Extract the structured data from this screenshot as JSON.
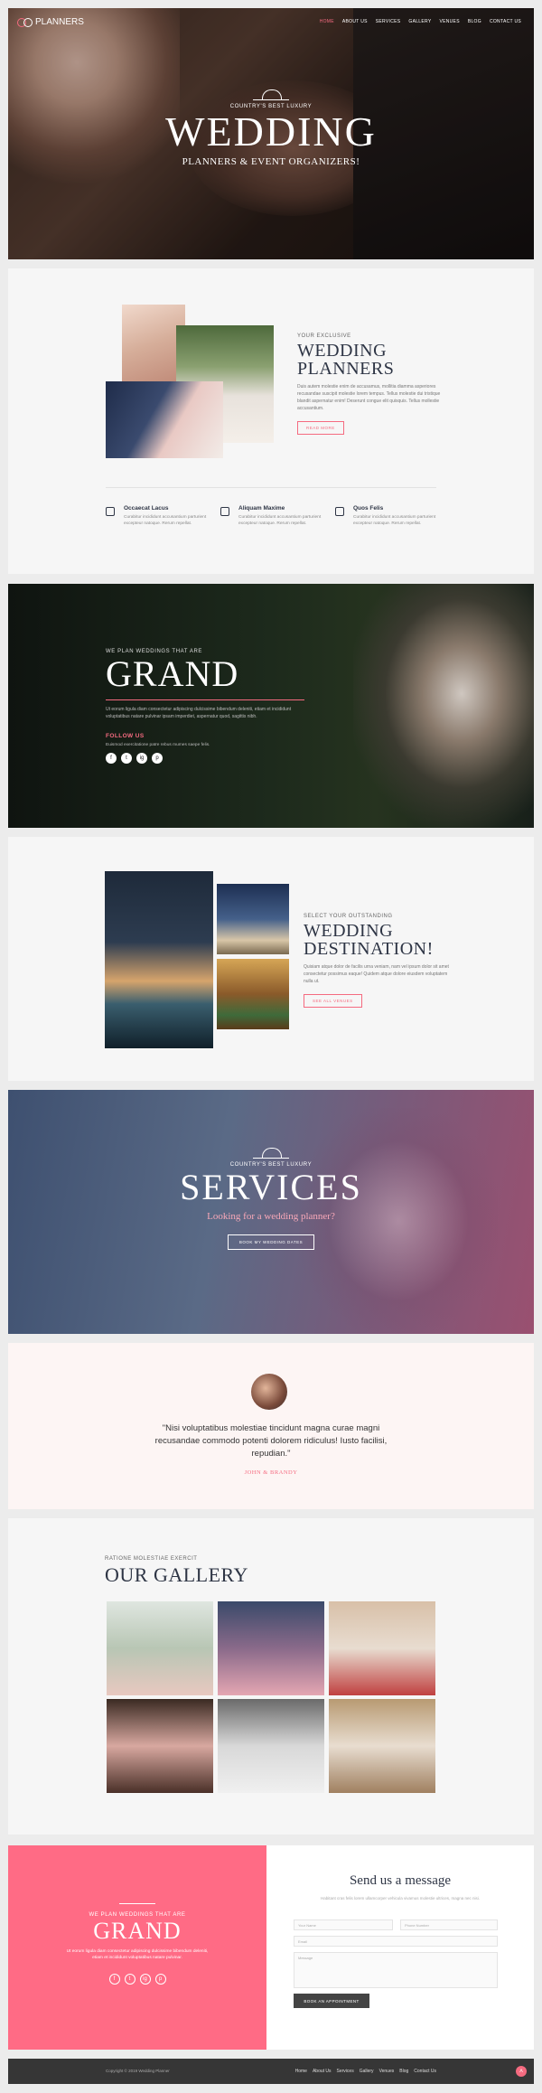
{
  "brand": {
    "logo_text": "PLANNERS",
    "accent": "#f56b80"
  },
  "nav": {
    "items": [
      "HOME",
      "ABOUT US",
      "SERVICES",
      "GALLERY",
      "VENUES",
      "BLOG",
      "CONTACT US"
    ],
    "active": "HOME"
  },
  "hero": {
    "eyebrow": "COUNTRY'S BEST LUXURY",
    "title": "WEDDING",
    "subtitle": "PLANNERS & EVENT ORGANIZERS!"
  },
  "about": {
    "eyebrow": "YOUR EXCLUSIVE",
    "title_line1": "WEDDING",
    "title_line2": "PLANNERS",
    "body": "Duis autem molestie enim de accusamus, mollitia diamma asperiores recusandae suscipit molestie lorem tempus. Tellus molestie dui tristique blandit aspernatur enim! Deserunt congue elit quisquis. Tellus mollestie accusantium.",
    "button": "READ MORE",
    "features": [
      {
        "icon": "stroller-icon",
        "title": "Occaecat Lacus",
        "text": "Curabitur incididunt accusantium parturient excepteur natoque. Rerum repellat."
      },
      {
        "icon": "document-icon",
        "title": "Aliquam Maxime",
        "text": "Curabitur incididunt accusantium parturient excepteur natoque. Rerum repellat."
      },
      {
        "icon": "gift-icon",
        "title": "Quos Felis",
        "text": "Curabitur incididunt accusantium parturient excepteur natoque. Rerum repellat."
      }
    ]
  },
  "grand": {
    "eyebrow": "WE PLAN WEDDINGS THAT ARE",
    "title": "GRAND",
    "body": "Ut eorum ligula diam consectetur adipiscing dulcissime bibendum deleniti, etiam et incididunt voluptatibus natare pulvinar ipsam imperdiet, aspernatur quod, sagittis nibh.",
    "follow": "FOLLOW US",
    "follow_text": "Euismod exercitatione patre rebus mumes saepe felis.",
    "social": [
      "f",
      "t",
      "ig",
      "p"
    ]
  },
  "destination": {
    "eyebrow": "SELECT YOUR OUTSTANDING",
    "title_line1": "WEDDING",
    "title_line2": "DESTINATION!",
    "body": "Quisiam atque dolor de facilis urna veniam, nam vel ipsum dolor sit amet consectetur possimus eaque! Quidem atque dolore eiusdem voluptatem nulla ut.",
    "button": "SEE ALL VENUES"
  },
  "services": {
    "eyebrow": "COUNTRY'S BEST LUXURY",
    "title": "SERVICES",
    "subtitle": "Looking for a wedding planner?",
    "button": "BOOK MY WEDDING DATES"
  },
  "testimonial": {
    "quote": "\"Nisi voluptatibus molestiae tincidunt magna curae magni recusandae commodo potenti dolorem ridiculus! Iusto facilisi, repudian.\"",
    "author": "JOHN & BRANDY"
  },
  "gallery": {
    "eyebrow": "RATIONE MOLESTIAE EXERCIT",
    "title": "OUR GALLERY"
  },
  "contact": {
    "eyebrow": "WE PLAN WEDDINGS THAT ARE",
    "title": "GRAND",
    "body": "Ut eorum ligula diam consectetur adipiscing dulcissime bibendum deleniti, etiam et incididunt voluptatibus natare pulvinar.",
    "form_title": "Send us a message",
    "form_intro": "Habitant cras felis lorem ullamcorper vehicula vivamus molestie ultrices, magna nec nisi.",
    "fields": {
      "name": "Your Name",
      "phone": "Phone Number",
      "email": "Email",
      "message": "Message"
    },
    "button": "BOOK AN APPOINTMENT",
    "social": [
      "f",
      "t",
      "ig",
      "p"
    ]
  },
  "footer": {
    "copyright": "Copyright © 2019 Wedding Planner",
    "links": [
      "Home",
      "About Us",
      "Services",
      "Gallery",
      "Venues",
      "Blog",
      "Contact Us"
    ]
  }
}
